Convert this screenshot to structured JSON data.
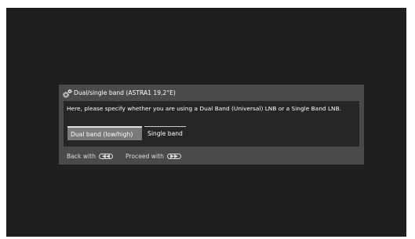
{
  "dialog": {
    "title": "Dual/single band (ASTRA1 19,2°E)",
    "description": "Here, please specify whether you are using a Dual Band (Universal) LNB or a Single Band LNB.",
    "options": [
      {
        "label": "Dual band (low/high)",
        "selected": true
      },
      {
        "label": "Single band",
        "selected": false
      }
    ],
    "footer": {
      "back_label": "Back with",
      "back_icon": "rewind-icon",
      "proceed_label": "Proceed with",
      "proceed_icon": "fast-forward-icon"
    }
  },
  "colors": {
    "screen_bg": "#1f1f1f",
    "dialog_bg": "#4a4a4a",
    "content_bg": "#262626",
    "selected_bg": "#7a7a7a"
  }
}
